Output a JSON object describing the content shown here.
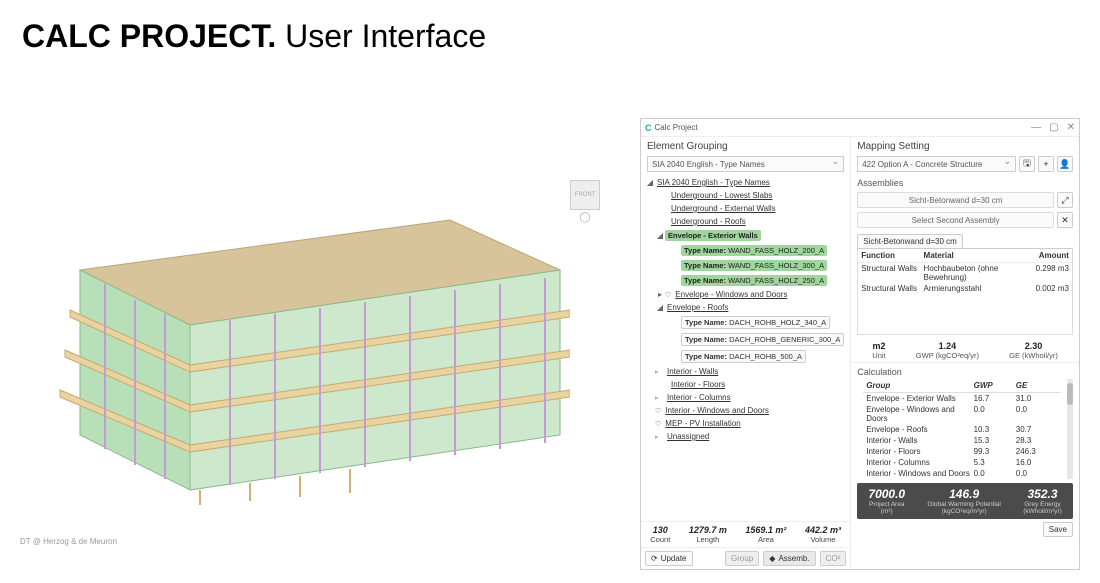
{
  "slide": {
    "title_bold": "CALC PROJECT.",
    "title_rest": " User Interface"
  },
  "footer_credit": "DT @ Herzog & de Meuron",
  "viewcube": {
    "label": "FRONT"
  },
  "window": {
    "app_title": "Calc Project",
    "min": "—",
    "max": "▢",
    "close": "✕"
  },
  "left": {
    "header": "Element Grouping",
    "dropdown": "SIA 2040 English - Type Names",
    "root": "SIA 2040 English - Type Names",
    "underground": {
      "slabs": "Underground - Lowest Slabs",
      "ext_walls": "Underground - External Walls",
      "roofs": "Underground - Roofs"
    },
    "envelope_walls": {
      "label": "Envelope - Exterior Walls",
      "children": [
        {
          "k": "Type Name:",
          "v": "WAND_FASS_HOLZ_200_A"
        },
        {
          "k": "Type Name:",
          "v": "WAND_FASS_HOLZ_300_A"
        },
        {
          "k": "Type Name:",
          "v": "WAND_FASS_HOLZ_250_A"
        }
      ]
    },
    "env_windows": "Envelope - Windows and Doors",
    "env_roofs": {
      "label": "Envelope - Roofs",
      "children": [
        {
          "k": "Type Name:",
          "v": "DACH_ROHB_HOLZ_340_A"
        },
        {
          "k": "Type Name:",
          "v": "DACH_ROHB_GENERIC_300_A"
        },
        {
          "k": "Type Name:",
          "v": "DACH_ROHB_500_A"
        }
      ]
    },
    "interior_walls": "Interior - Walls",
    "interior_floors": "Interior - Floors",
    "interior_cols": "Interior - Columns",
    "interior_wd": "Interior - Windows and Doors",
    "mep": "MEP - PV Installation",
    "unassigned": "Unassigned",
    "stats": {
      "count": {
        "v": "130",
        "l": "Count"
      },
      "length": {
        "v": "1279.7 m",
        "l": "Length"
      },
      "area": {
        "v": "1569.1 m²",
        "l": "Area"
      },
      "volume": {
        "v": "442.2 m³",
        "l": "Volume"
      }
    },
    "update": "Update",
    "group": "Group",
    "assemb": "Assemb.",
    "co2": "CO²"
  },
  "right": {
    "header": "Mapping Setting",
    "mapping_dropdown": "422 Option A - Concrete Structure",
    "save_icon": "🖫",
    "plus": "+",
    "user": "👤",
    "assemblies_label": "Assemblies",
    "assembly1": "Sicht-Betonwand d=30 cm",
    "assembly2": "Select Second Assembly",
    "expand": "⤢",
    "close_small": "✕",
    "tab": "Sicht-Betonwand d=30 cm",
    "asm_table": {
      "h_fn": "Function",
      "h_mat": "Material",
      "h_amt": "Amount",
      "rows": [
        {
          "fn": "Structural Walls",
          "mat": "Hochbaubeton (ohne Bewehrung)",
          "amt": "0.298 m3"
        },
        {
          "fn": "Structural Walls",
          "mat": "Armierungsstahl",
          "amt": "0.002 m3"
        }
      ]
    },
    "asm_metrics": {
      "m2": {
        "v": "m2",
        "l": "Unit"
      },
      "gwp": {
        "v": "1.24",
        "l": "GWP (kgCO²eq/yr)"
      },
      "ge": {
        "v": "2.30",
        "l": "GE (kWhoil/yr)"
      }
    },
    "calc_header": "Calculation",
    "calc_cols": {
      "g": "Group",
      "gwp": "GWP",
      "ge": "GE"
    },
    "calc_rows": [
      {
        "g": "Envelope - Exterior Walls",
        "gwp": "16.7",
        "ge": "31.0"
      },
      {
        "g": "Envelope - Windows and Doors",
        "gwp": "0.0",
        "ge": "0.0"
      },
      {
        "g": "Envelope - Roofs",
        "gwp": "10.3",
        "ge": "30.7"
      },
      {
        "g": "Interior - Walls",
        "gwp": "15.3",
        "ge": "28.3"
      },
      {
        "g": "Interior - Floors",
        "gwp": "99.3",
        "ge": "246.3"
      },
      {
        "g": "Interior - Columns",
        "gwp": "5.3",
        "ge": "16.0"
      },
      {
        "g": "Interior - Windows and Doors",
        "gwp": "0.0",
        "ge": "0.0"
      }
    ],
    "dark": {
      "pa": {
        "v": "7000.0",
        "l": "Project Area",
        "u": "(m²)"
      },
      "gwp": {
        "v": "146.9",
        "l": "Global Warming Potential",
        "u": "(kgCO²eq/m²yr)"
      },
      "ge": {
        "v": "352.3",
        "l": "Grey Energy",
        "u": "(kWhoil/m²yr)"
      }
    },
    "save": "Save"
  }
}
